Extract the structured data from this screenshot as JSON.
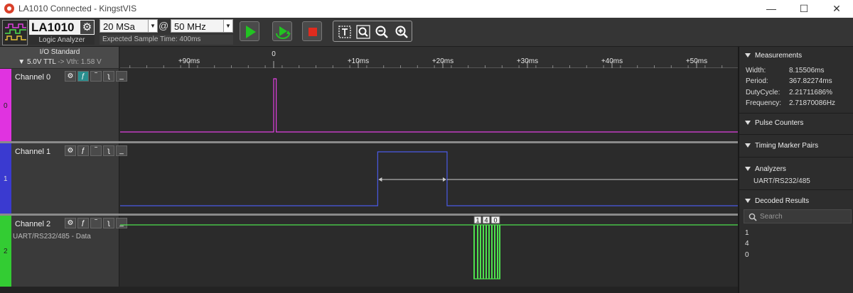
{
  "window": {
    "title": "LA1010 Connected - KingstVIS",
    "minimize": "—",
    "maximize": "☐",
    "close": "✕"
  },
  "toolbar": {
    "device_name": "LA1010",
    "device_subtitle": "Logic Analyzer",
    "sample_depth": "20 MSa",
    "at_sign": "@",
    "sample_rate": "50 MHz",
    "expected_time": "Expected Sample Time: 400ms",
    "icons": {
      "run": "play-icon",
      "loop": "loop-icon",
      "stop": "stop-icon",
      "text": "text-icon",
      "zoom_fit": "zoom-fit-icon",
      "zoom_out": "zoom-out-icon",
      "zoom_in": "zoom-in-icon"
    },
    "colors": {
      "run": "#22c322",
      "loop": "#22c322",
      "stop": "#e02b1e"
    }
  },
  "io": {
    "title": "I/O Standard",
    "standard": "5.0V TTL",
    "vth": "-> Vth: 1.58 V"
  },
  "ruler": {
    "marks": [
      {
        "label": "+90ms",
        "t": -10
      },
      {
        "label": "0",
        "t": 0
      },
      {
        "label": "+10ms",
        "t": 10
      },
      {
        "label": "+20ms",
        "t": 20
      },
      {
        "label": "+30ms",
        "t": 30
      },
      {
        "label": "+40ms",
        "t": 40
      },
      {
        "label": "+50ms",
        "t": 50
      }
    ]
  },
  "channels": [
    {
      "name": "Channel 0",
      "index": "0",
      "color": "#e033e0",
      "trace_color": "#e040e0",
      "subtitle": "",
      "pulse_ms": [
        0,
        0.3
      ]
    },
    {
      "name": "Channel 1",
      "index": "1",
      "color": "#3a3ad0",
      "trace_color": "#4a5ae6",
      "subtitle": "",
      "pulse_ms": [
        12.3,
        20.5
      ]
    },
    {
      "name": "Channel 2",
      "index": "2",
      "color": "#33cc33",
      "trace_color": "#4ee04e",
      "subtitle": "UART/RS232/485 - Data",
      "decoded": [
        "1",
        "4",
        "0"
      ]
    }
  ],
  "measurements": {
    "title": "Measurements",
    "rows": [
      {
        "label": "Width:",
        "value": "8.15506ms"
      },
      {
        "label": "Period:",
        "value": "367.82274ms"
      },
      {
        "label": "DutyCycle:",
        "value": "2.21711686%"
      },
      {
        "label": "Frequency:",
        "value": "2.71870086Hz"
      }
    ]
  },
  "pulse_counters": {
    "title": "Pulse Counters"
  },
  "timing_markers": {
    "title": "Timing Marker Pairs"
  },
  "analyzers": {
    "title": "Analyzers",
    "items": [
      "UART/RS232/485"
    ]
  },
  "decoded_results": {
    "title": "Decoded Results",
    "search_placeholder": "Search",
    "items": [
      "1",
      "4",
      "0"
    ]
  }
}
